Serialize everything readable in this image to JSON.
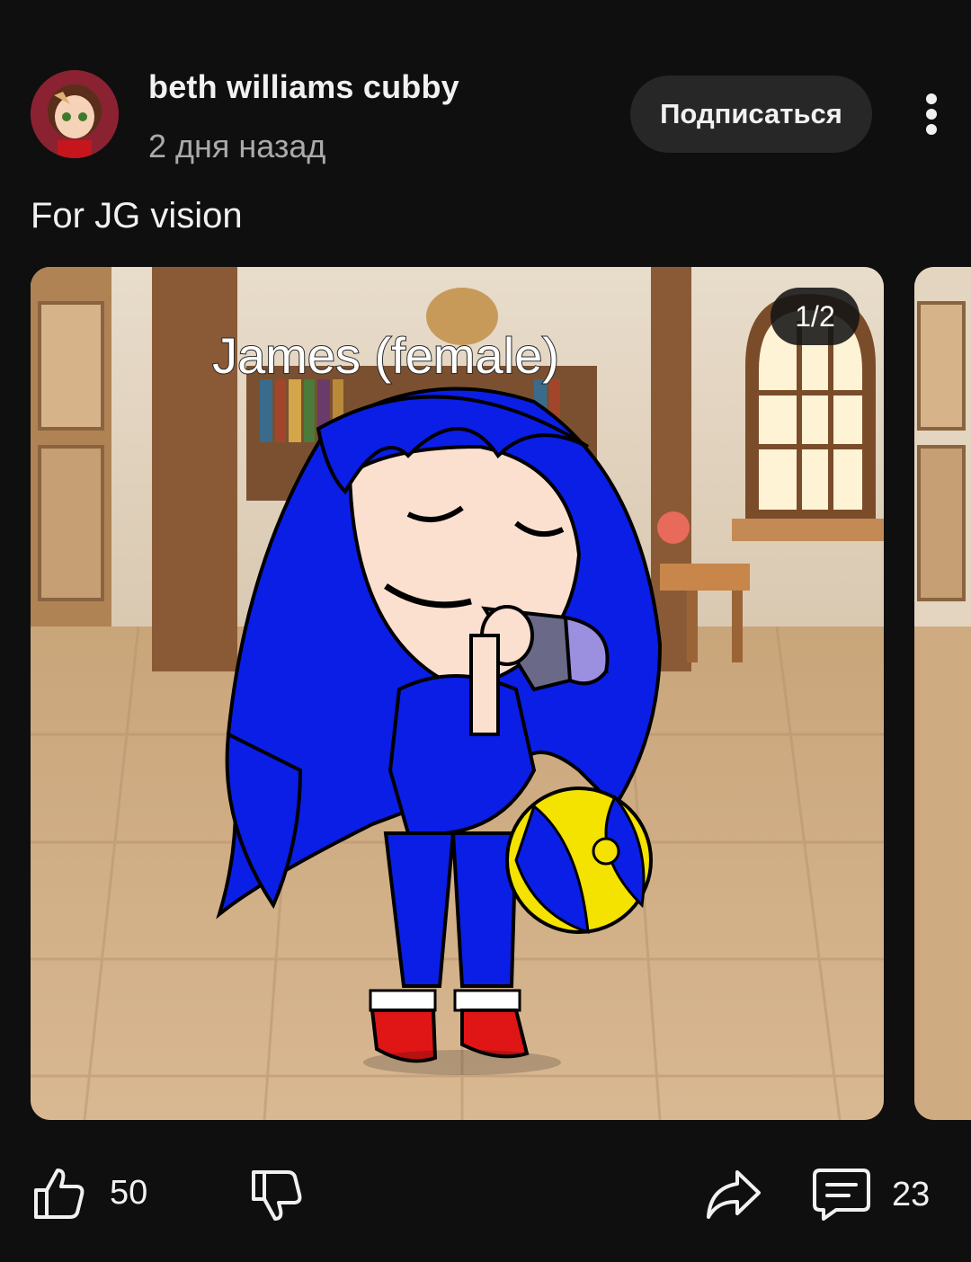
{
  "post": {
    "channel_name": "beth williams cubby",
    "time_ago": "2 дня назад",
    "subscribe_label": "Подписаться",
    "text": "For JG vision",
    "image_counter": "1/2",
    "image_caption": "James (female)",
    "likes": "50",
    "comments": "23"
  },
  "icons": {
    "more": "more-vert-icon",
    "like": "thumb-up-icon",
    "dislike": "thumb-down-icon",
    "share": "share-icon",
    "comments": "comment-icon"
  },
  "colors": {
    "background": "#0f0f0f",
    "subscribe_bg": "#272727",
    "secondary_text": "#aaaaaa",
    "hair_blue": "#0a1ee6"
  }
}
